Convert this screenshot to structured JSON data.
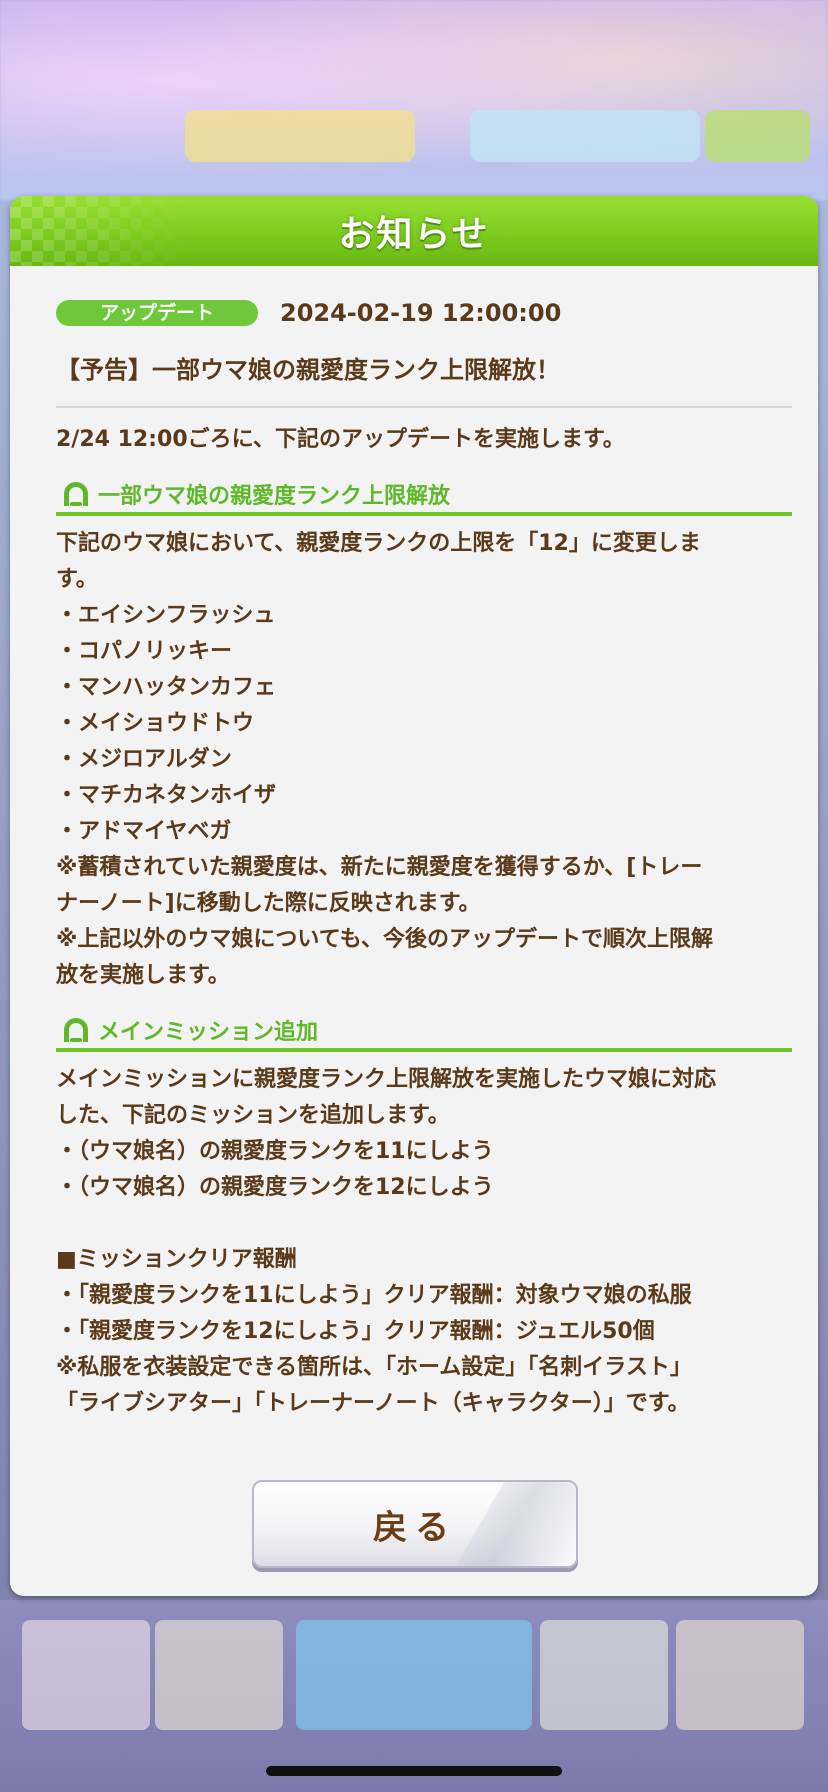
{
  "dialog": {
    "title": "お知らせ",
    "back_label": "戻る"
  },
  "notice": {
    "category_tag": "アップデート",
    "datetime": "2024-02-19 12:00:00",
    "title": "【予告】一部ウマ娘の親愛度ランク上限解放！",
    "intro": "2/24 12:00ごろに、下記のアップデートを実施します。"
  },
  "sections": [
    {
      "heading": "一部ウマ娘の親愛度ランク上限解放",
      "lines": [
        "下記のウマ娘において、親愛度ランクの上限を「12」に変更しま",
        "す。",
        "・エイシンフラッシュ",
        "・コパノリッキー",
        "・マンハッタンカフェ",
        "・メイショウドトウ",
        "・メジロアルダン",
        "・マチカネタンホイザ",
        "・アドマイヤベガ",
        "※蓄積されていた親愛度は、新たに親愛度を獲得するか、[トレー",
        "ナーノート]に移動した際に反映されます。",
        "※上記以外のウマ娘についても、今後のアップデートで順次上限解",
        "放を実施します。"
      ]
    },
    {
      "heading": "メインミッション追加",
      "lines": [
        "メインミッションに親愛度ランク上限解放を実施したウマ娘に対応",
        "した、下記のミッションを追加します。",
        "・（ウマ娘名）の親愛度ランクを11にしよう",
        "・（ウマ娘名）の親愛度ランクを12にしよう"
      ],
      "lines2": [
        "■ミッションクリア報酬",
        "・「親愛度ランクを11にしよう」クリア報酬：対象ウマ娘の私服",
        "・「親愛度ランクを12にしよう」クリア報酬：ジュエル50個",
        "※私服を衣装設定できる箇所は、「ホーム設定」「名刺イラスト」",
        "「ライブシアター」「トレーナーノート（キャラクター）」です。"
      ]
    }
  ],
  "colors": {
    "header_green": "#7ccc1e",
    "section_green": "#5fb82a",
    "text_brown": "#5a3a1a",
    "tag_green": "#6fc83a"
  }
}
